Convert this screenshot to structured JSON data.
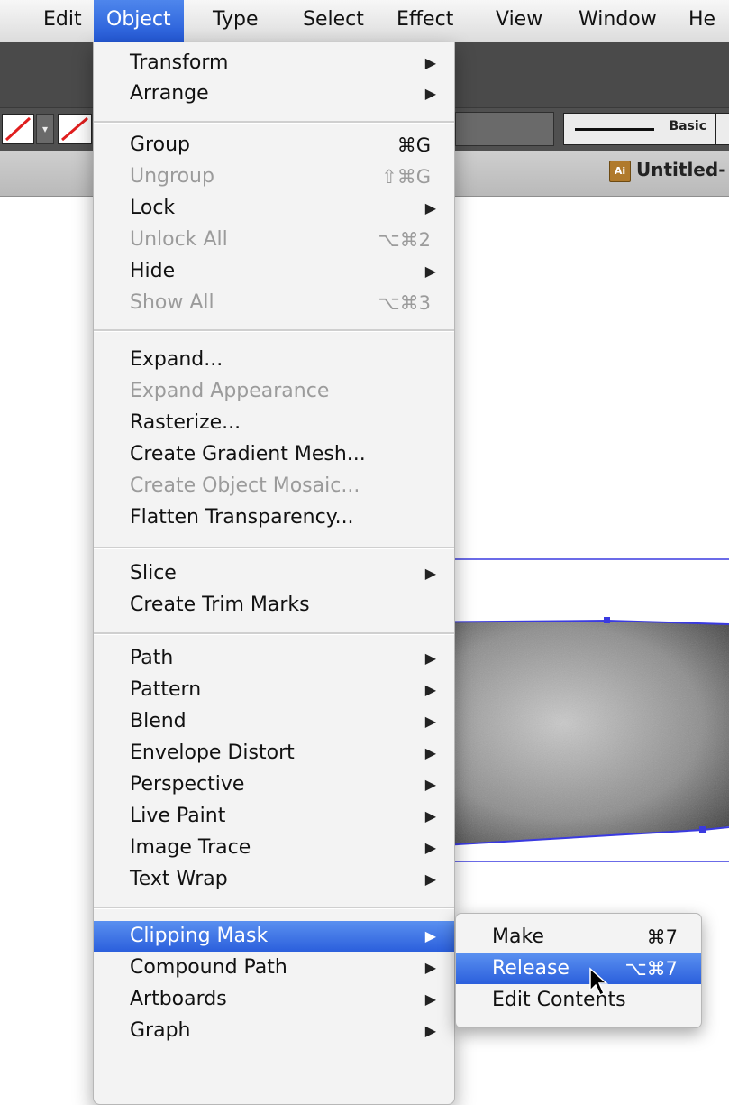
{
  "menubar": {
    "items": [
      "Edit",
      "Object",
      "Type",
      "Select",
      "Effect",
      "View",
      "Window",
      "He"
    ],
    "active": "Object"
  },
  "control_bar": {
    "stroke_profile_label": "Basic"
  },
  "document_tab": {
    "title": "Untitled-",
    "icon": "document-icon"
  },
  "object_menu": {
    "items": [
      {
        "label": "Transform",
        "submenu": true
      },
      {
        "label": "Arrange",
        "submenu": true
      },
      {
        "label": "Group",
        "shortcut": "⌘G"
      },
      {
        "label": "Ungroup",
        "shortcut": "⇧⌘G",
        "disabled": true
      },
      {
        "label": "Lock",
        "submenu": true
      },
      {
        "label": "Unlock All",
        "shortcut": "⌥⌘2",
        "disabled": true
      },
      {
        "label": "Hide",
        "submenu": true
      },
      {
        "label": "Show All",
        "shortcut": "⌥⌘3",
        "disabled": true
      },
      {
        "label": "Expand..."
      },
      {
        "label": "Expand Appearance",
        "disabled": true
      },
      {
        "label": "Rasterize..."
      },
      {
        "label": "Create Gradient Mesh..."
      },
      {
        "label": "Create Object Mosaic...",
        "disabled": true
      },
      {
        "label": "Flatten Transparency..."
      },
      {
        "label": "Slice",
        "submenu": true
      },
      {
        "label": "Create Trim Marks"
      },
      {
        "label": "Path",
        "submenu": true
      },
      {
        "label": "Pattern",
        "submenu": true
      },
      {
        "label": "Blend",
        "submenu": true
      },
      {
        "label": "Envelope Distort",
        "submenu": true
      },
      {
        "label": "Perspective",
        "submenu": true
      },
      {
        "label": "Live Paint",
        "submenu": true
      },
      {
        "label": "Image Trace",
        "submenu": true
      },
      {
        "label": "Text Wrap",
        "submenu": true
      },
      {
        "label": "Clipping Mask",
        "submenu": true,
        "highlighted": true
      },
      {
        "label": "Compound Path",
        "submenu": true
      },
      {
        "label": "Artboards",
        "submenu": true
      },
      {
        "label": "Graph",
        "submenu": true
      }
    ],
    "submenu_arrow": "▶"
  },
  "clipping_mask_submenu": {
    "items": [
      {
        "label": "Make",
        "shortcut": "⌘7"
      },
      {
        "label": "Release",
        "shortcut": "⌥⌘7",
        "highlighted": true
      },
      {
        "label": "Edit Contents"
      }
    ]
  },
  "colors": {
    "selection_blue": "#2b5fdc",
    "path_blue": "#3a3ae0",
    "disabled_text": "#9b9b9b"
  }
}
